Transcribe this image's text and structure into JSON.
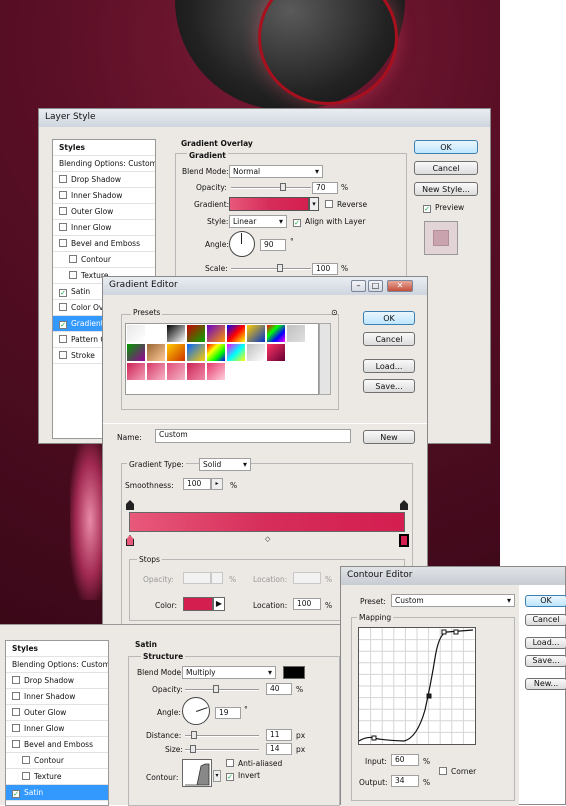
{
  "layer_style": {
    "title": "Layer Style",
    "styles_header": "Styles",
    "blending_options": "Blending Options: Custom",
    "effects": [
      {
        "label": "Drop Shadow",
        "checked": false,
        "indent": false
      },
      {
        "label": "Inner Shadow",
        "checked": false,
        "indent": false
      },
      {
        "label": "Outer Glow",
        "checked": false,
        "indent": false
      },
      {
        "label": "Inner Glow",
        "checked": false,
        "indent": false
      },
      {
        "label": "Bevel and Emboss",
        "checked": false,
        "indent": false
      },
      {
        "label": "Contour",
        "checked": false,
        "indent": true
      },
      {
        "label": "Texture",
        "checked": false,
        "indent": true
      },
      {
        "label": "Satin",
        "checked": true,
        "indent": false
      },
      {
        "label": "Color Overlay",
        "checked": false,
        "indent": false
      },
      {
        "label": "Gradient Overlay",
        "checked": true,
        "indent": false,
        "selected": true
      },
      {
        "label": "Pattern Overlay",
        "checked": false,
        "indent": false
      },
      {
        "label": "Stroke",
        "checked": false,
        "indent": false
      }
    ],
    "section_title": "Gradient Overlay",
    "group_title": "Gradient",
    "blend_mode_label": "Blend Mode:",
    "blend_mode": "Normal",
    "opacity_label": "Opacity:",
    "opacity": "70",
    "opacity_unit": "%",
    "gradient_label": "Gradient:",
    "reverse_label": "Reverse",
    "style_label": "Style:",
    "style": "Linear",
    "align_label": "Align with Layer",
    "angle_label": "Angle:",
    "angle": "90",
    "angle_unit": "°",
    "scale_label": "Scale:",
    "scale": "100",
    "scale_unit": "%",
    "ok": "OK",
    "cancel": "Cancel",
    "new_style": "New Style...",
    "preview": "Preview"
  },
  "gradient_editor": {
    "title": "Gradient Editor",
    "presets_label": "Presets",
    "ok": "OK",
    "cancel": "Cancel",
    "load": "Load...",
    "save": "Save...",
    "name_label": "Name:",
    "name": "Custom",
    "new": "New",
    "gradient_type_label": "Gradient Type:",
    "gradient_type": "Solid",
    "smoothness_label": "Smoothness:",
    "smoothness": "100",
    "smoothness_unit": "%",
    "stops_label": "Stops",
    "opacity_label": "Opacity:",
    "opacity_unit": "%",
    "location_label": "Location:",
    "location_unit": "%",
    "color_label": "Color:",
    "color_location_label": "Location:",
    "color_location": "100",
    "color_location_unit": "%",
    "preset_swatches": [
      [
        "#e8e8e8,#ffffff",
        "#ffffff,#ffffff",
        "#000000,#ffffff",
        "#cc0000,#00aa00",
        "#6600cc,#ff9900",
        "#0000ff,#ff0000,#ffff00",
        "#ffcc00,#0033cc",
        "#ff0000,#00ff00,#0000ff,#ff00ff",
        "#c0c0c0,#e0e0e0"
      ],
      [
        "#009900,#990099",
        "#996633,#ffcc99",
        "#ffcc00,#cc3300",
        "#0066ff,#ffcc00",
        "#ff0000,#ffff00,#00ff00,#0000ff",
        "#ff00ff,#00ffff,#ffff00",
        "#c0c0c0,#ffffff",
        "#ff3366,#660033"
      ],
      [
        "#cc2255,#f5a0b8",
        "#d63a66,#f7b3c8",
        "#e24b77,#f2b6c8",
        "#cc2255,#f08aa8",
        "#e5396a,#ffd0de"
      ]
    ],
    "gradient_colors": [
      "#e8597a",
      "#d62d5a",
      "#d41e50"
    ],
    "stop_color": "#d41e50"
  },
  "contour_editor": {
    "title": "Contour Editor",
    "preset_label": "Preset:",
    "preset": "Custom",
    "mapping_label": "Mapping",
    "input_label": "Input:",
    "input": "60",
    "input_unit": "%",
    "output_label": "Output:",
    "output": "34",
    "output_unit": "%",
    "corner_label": "Corner",
    "ok": "OK",
    "cancel": "Cancel",
    "load": "Load...",
    "save": "Save...",
    "new": "New..."
  },
  "satin_panel": {
    "styles_header": "Styles",
    "blending_options": "Blending Options: Custom",
    "effects": [
      {
        "label": "Drop Shadow",
        "checked": false,
        "indent": false
      },
      {
        "label": "Inner Shadow",
        "checked": false,
        "indent": false
      },
      {
        "label": "Outer Glow",
        "checked": false,
        "indent": false
      },
      {
        "label": "Inner Glow",
        "checked": false,
        "indent": false
      },
      {
        "label": "Bevel and Emboss",
        "checked": false,
        "indent": false
      },
      {
        "label": "Contour",
        "checked": false,
        "indent": true
      },
      {
        "label": "Texture",
        "checked": false,
        "indent": true
      },
      {
        "label": "Satin",
        "checked": true,
        "indent": false,
        "selected": true
      }
    ],
    "section_title": "Satin",
    "group_title": "Structure",
    "blend_mode_label": "Blend Mode:",
    "blend_mode": "Multiply",
    "blend_color": "#000000",
    "opacity_label": "Opacity:",
    "opacity": "40",
    "opacity_unit": "%",
    "angle_label": "Angle:",
    "angle": "19",
    "angle_unit": "°",
    "distance_label": "Distance:",
    "distance": "11",
    "distance_unit": "px",
    "size_label": "Size:",
    "size": "14",
    "size_unit": "px",
    "contour_label": "Contour:",
    "anti_aliased": "Anti-aliased",
    "invert": "Invert"
  },
  "colors": {
    "accent": "#3399ff",
    "gradient_main": "#d41e50"
  }
}
